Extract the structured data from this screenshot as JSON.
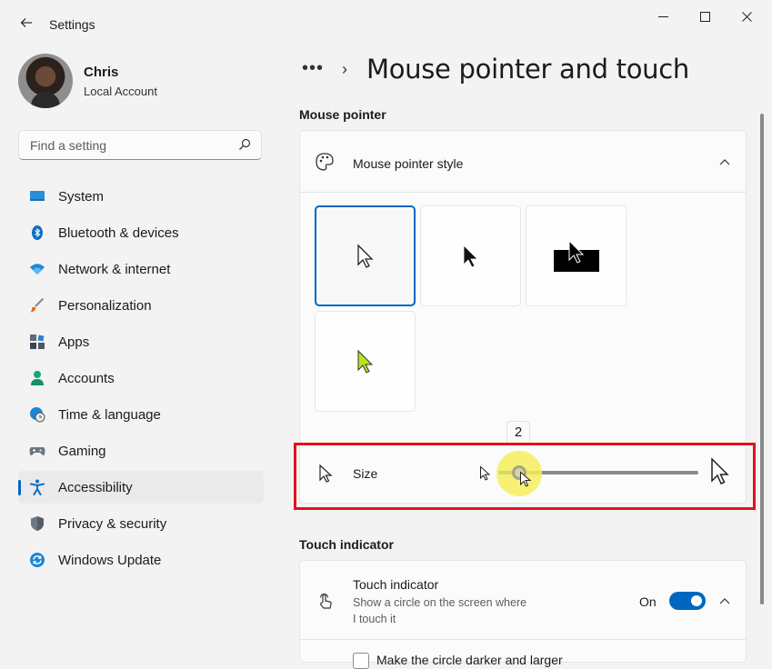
{
  "window": {
    "title": "Settings",
    "back_icon": "arrow-left-icon",
    "minimize_glyph": "—",
    "maximize_glyph": "☐",
    "close_glyph": "✕"
  },
  "profile": {
    "name": "Chris",
    "account_type": "Local Account"
  },
  "search": {
    "placeholder": "Find a setting",
    "value": ""
  },
  "sidebar": {
    "active_index": 8,
    "items": [
      {
        "label": "System",
        "icon": "system-icon"
      },
      {
        "label": "Bluetooth & devices",
        "icon": "bluetooth-icon"
      },
      {
        "label": "Network & internet",
        "icon": "wifi-icon"
      },
      {
        "label": "Personalization",
        "icon": "brush-icon"
      },
      {
        "label": "Apps",
        "icon": "apps-icon"
      },
      {
        "label": "Accounts",
        "icon": "person-icon"
      },
      {
        "label": "Time & language",
        "icon": "globe-clock-icon"
      },
      {
        "label": "Gaming",
        "icon": "gamepad-icon"
      },
      {
        "label": "Accessibility",
        "icon": "accessibility-icon"
      },
      {
        "label": "Privacy & security",
        "icon": "shield-icon"
      },
      {
        "label": "Windows Update",
        "icon": "update-icon"
      }
    ]
  },
  "header": {
    "breadcrumb_dots": "•••",
    "breadcrumb_separator": "›",
    "title": "Mouse pointer and touch"
  },
  "mouse_pointer": {
    "section_label": "Mouse pointer",
    "style_row": {
      "title": "Mouse pointer style",
      "expanded": true
    },
    "styles": [
      {
        "name": "White",
        "selected": true
      },
      {
        "name": "Black",
        "selected": false
      },
      {
        "name": "Inverted",
        "selected": false
      },
      {
        "name": "Custom",
        "selected": false,
        "color": "#b5e61d"
      }
    ],
    "size": {
      "label": "Size",
      "value": 2,
      "min": 1,
      "max": 15,
      "tooltip": "2"
    }
  },
  "touch_indicator": {
    "section_label": "Touch indicator",
    "title": "Touch indicator",
    "description_line1": "Show a circle on the screen where",
    "description_line2": "I touch it",
    "toggle_label": "On",
    "toggle_on": true,
    "next_row_text": "Make the circle darker and larger"
  },
  "colors": {
    "accent": "#0067c0",
    "highlight_box": "#e0121c"
  }
}
